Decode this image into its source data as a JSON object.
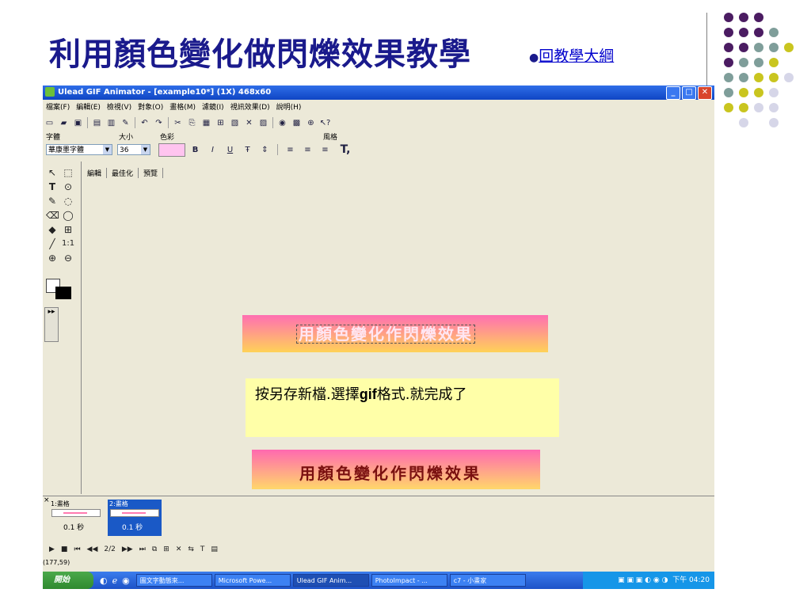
{
  "slide": {
    "title": "利用顏色變化做閃爍效果教學",
    "bullet": "●",
    "back_link": "回教學大綱"
  },
  "decor_colors": [
    "#4b1c62",
    "#7f9e9a",
    "#c9c51f",
    "#d6d6e8"
  ],
  "app": {
    "window_title": "Ulead GIF Animator - [example10*] (1X) 468x60",
    "menu": [
      "檔案(F)",
      "編輯(E)",
      "檢視(V)",
      "對象(O)",
      "畫格(M)",
      "濾鏡(I)",
      "視訊效果(D)",
      "說明(H)"
    ],
    "text_toolbar": {
      "font_label": "字體",
      "font_value": "華康墨字體",
      "size_label": "大小",
      "size_value": "36",
      "color_label": "色彩",
      "color_value": "#ffc4ef",
      "style_label": "風格",
      "style_glyph": "T,"
    },
    "tabs": [
      "編輯",
      "最佳化",
      "預覽"
    ],
    "canvas": {
      "banner1_text": "用顏色變化作閃爍效果",
      "note_prefix": "按另存新檔.選擇",
      "note_bold": "gif",
      "note_suffix": "格式.就完成了",
      "banner2_text": "用顏色變化作閃爍效果"
    },
    "frames": [
      {
        "label": "1:畫格",
        "duration": "0.1 秒",
        "selected": false
      },
      {
        "label": "2:畫格",
        "duration": "0.1 秒",
        "selected": true
      }
    ],
    "playbar_counter": "2/2",
    "coords": "(177,59)",
    "taskbar": {
      "start": "開始",
      "tasks": [
        "圖文字動態來...",
        "Microsoft Powe...",
        "Ulead GIF Anim...",
        "PhotoImpact - ...",
        "c7 - 小畫家"
      ],
      "clock": "下午 04:20"
    }
  }
}
